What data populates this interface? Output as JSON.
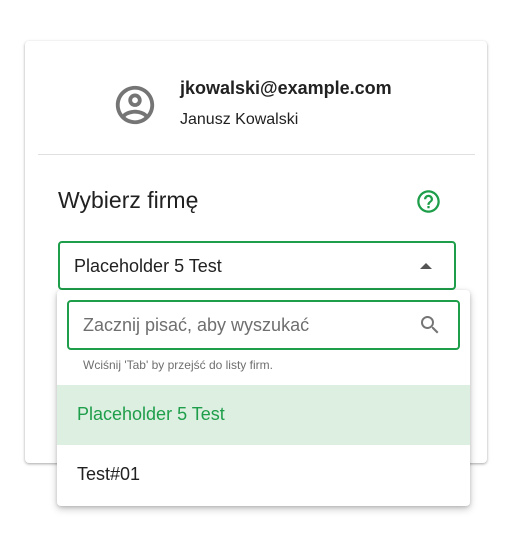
{
  "user": {
    "email": "jkowalski@example.com",
    "name": "Janusz Kowalski",
    "avatar_icon": "account-circle-icon"
  },
  "company_select": {
    "title": "Wybierz firmę",
    "help_icon": "help-circle-icon",
    "selected_value": "Placeholder 5 Test",
    "expanded": true
  },
  "dropdown": {
    "search_placeholder": "Zacznij pisać, aby wyszukać",
    "search_value": "",
    "search_icon": "search-icon",
    "hint": "Wciśnij 'Tab' by przejść do listy firm.",
    "options": [
      {
        "label": "Placeholder 5 Test",
        "selected": true
      },
      {
        "label": "Test#01",
        "selected": false
      }
    ]
  },
  "colors": {
    "accent": "#1e9e4a",
    "selected_bg": "#dcefe1",
    "text": "#212121",
    "muted": "#6f6f6f"
  }
}
